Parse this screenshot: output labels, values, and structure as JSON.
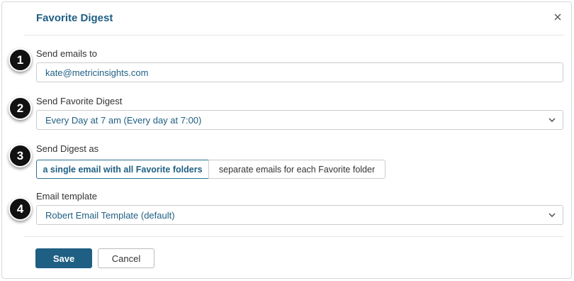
{
  "dialog": {
    "title": "Favorite Digest",
    "close_icon": "close-icon"
  },
  "fields": {
    "send_emails_to": {
      "label": "Send emails to",
      "value": "kate@metricinsights.com"
    },
    "send_favorite_digest": {
      "label": "Send Favorite Digest",
      "selected": "Every Day at 7 am (Every day at 7:00)"
    },
    "send_digest_as": {
      "label": "Send Digest as",
      "options": [
        "a single email with all Favorite folders",
        "separate emails for each Favorite folder"
      ],
      "selected_index": 0
    },
    "email_template": {
      "label": "Email template",
      "selected": "Robert Email Template (default)"
    }
  },
  "badges": [
    "1",
    "2",
    "3",
    "4"
  ],
  "buttons": {
    "save": "Save",
    "cancel": "Cancel"
  },
  "colors": {
    "accent": "#1f5f83",
    "badge": "#111111"
  }
}
